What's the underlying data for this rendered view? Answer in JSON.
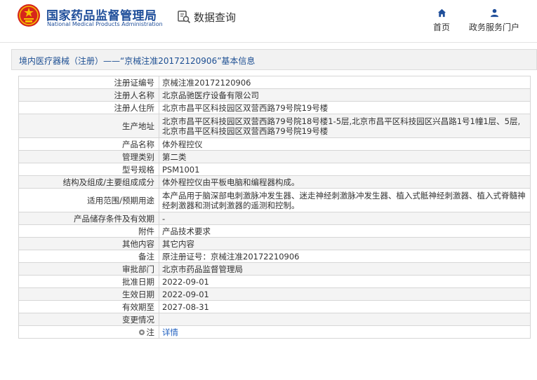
{
  "header": {
    "site_name_cn": "国家药品监督管理局",
    "site_name_en": "National Medical Products Administration",
    "data_query_label": "数据查询",
    "nav": [
      {
        "label": "首页",
        "icon": "home-icon"
      },
      {
        "label": "政务服务门户",
        "icon": "user-icon"
      }
    ]
  },
  "title": "境内医疗器械（注册）——“京械注准20172120906”基本信息",
  "rows": [
    {
      "label": "注册证编号",
      "value": "京械注准20172120906"
    },
    {
      "label": "注册人名称",
      "value": "北京品驰医疗设备有限公司"
    },
    {
      "label": "注册人住所",
      "value": "北京市昌平区科技园区双营西路79号院19号楼"
    },
    {
      "label": "生产地址",
      "value": "北京市昌平区科技园区双营西路79号院18号楼1-5层,北京市昌平区科技园区兴昌路1号1幢1层、5层,北京市昌平区科技园区双营西路79号院19号楼"
    },
    {
      "label": "产品名称",
      "value": "体外程控仪"
    },
    {
      "label": "管理类别",
      "value": "第二类"
    },
    {
      "label": "型号规格",
      "value": "PSM1001"
    },
    {
      "label": "结构及组成/主要组成成分",
      "value": "体外程控仪由平板电脑和编程器构成。"
    },
    {
      "label": "适用范围/预期用途",
      "value": "本产品用于脑深部电刺激脉冲发生器、迷走神经刺激脉冲发生器、植入式骶神经刺激器、植入式脊髓神经刺激器和测试刺激器的遥测和控制。"
    },
    {
      "label": "产品储存条件及有效期",
      "value": "-"
    },
    {
      "label": "附件",
      "value": "产品技术要求"
    },
    {
      "label": "其他内容",
      "value": "其它内容"
    },
    {
      "label": "备注",
      "value": "原注册证号：京械注准20172210906"
    },
    {
      "label": "审批部门",
      "value": "北京市药品监督管理局"
    },
    {
      "label": "批准日期",
      "value": "2022-09-01"
    },
    {
      "label": "生效日期",
      "value": "2022-09-01"
    },
    {
      "label": "有效期至",
      "value": "2027-08-31"
    },
    {
      "label": "变更情况",
      "value": ""
    },
    {
      "label": "注",
      "value": "详情"
    }
  ],
  "colors": {
    "brand_blue": "#1f4e9a",
    "link_blue": "#1f5fbf",
    "emblem_red": "#d7261b",
    "emblem_gold": "#f6c300"
  }
}
